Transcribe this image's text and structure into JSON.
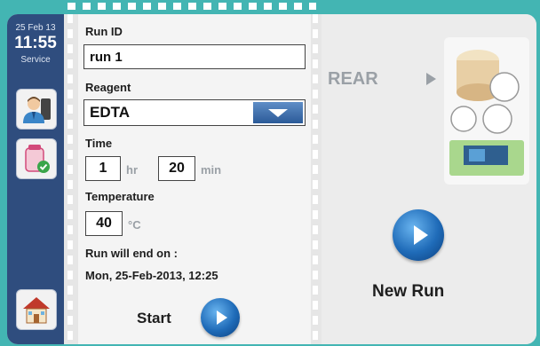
{
  "sidebar": {
    "date": "25 Feb 13",
    "time": "11:55",
    "status": "Service",
    "buttons": [
      "user-icon",
      "tube-check-icon",
      "home-icon"
    ]
  },
  "form": {
    "run_id_label": "Run ID",
    "run_id_value": "run 1",
    "reagent_label": "Reagent",
    "reagent_value": "EDTA",
    "time_label": "Time",
    "time_hr_value": "1",
    "time_hr_unit": "hr",
    "time_min_value": "20",
    "time_min_unit": "min",
    "temperature_label": "Temperature",
    "temperature_value": "40",
    "temperature_unit": "°C",
    "end_label": "Run will end on :",
    "end_value": "Mon, 25-Feb-2013, 12:25",
    "start_label": "Start"
  },
  "preview": {
    "rear_label": "REAR",
    "new_run_label": "New Run"
  },
  "colors": {
    "frame": "#43b5b3",
    "sidebar": "#2f4d7e",
    "button_blue": "#1f6bb8"
  }
}
